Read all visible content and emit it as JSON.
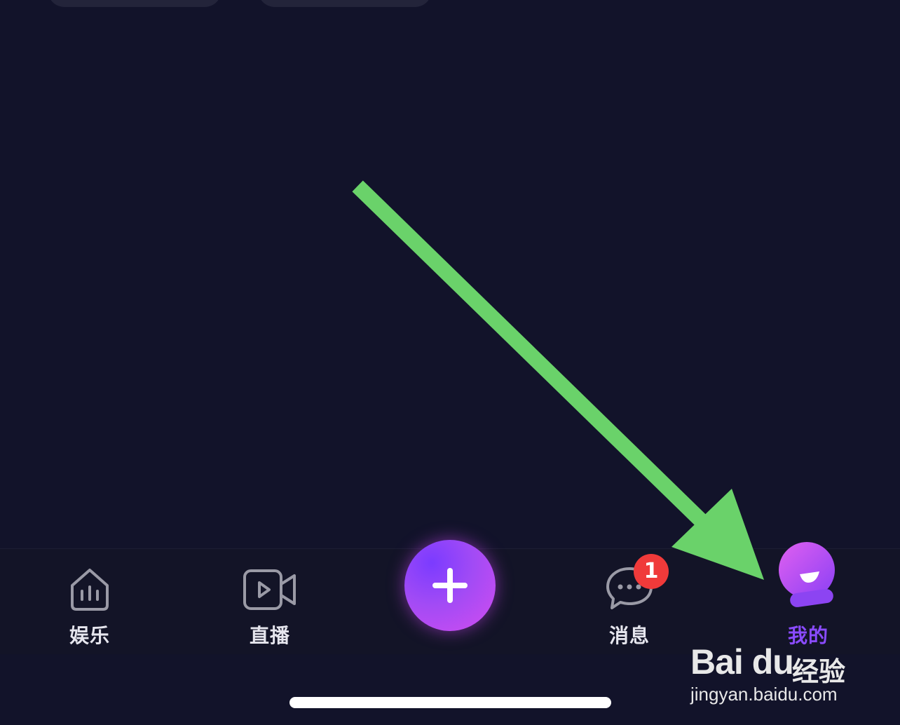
{
  "tabbar": {
    "items": [
      {
        "label": "娱乐",
        "icon": "home-icon",
        "active": false
      },
      {
        "label": "直播",
        "icon": "video-camera-icon",
        "active": false
      },
      {
        "label": "",
        "icon": "plus-icon",
        "active": false
      },
      {
        "label": "消息",
        "icon": "chat-bubble-icon",
        "active": false
      },
      {
        "label": "我的",
        "icon": "profile-mascot-icon",
        "active": true
      }
    ],
    "message_badge": "1"
  },
  "watermark": {
    "logo_text": "Bai du",
    "product": "经验",
    "url": "jingyan.baidu.com"
  },
  "colors": {
    "background": "#12132a",
    "accent": "#8a4bff",
    "badge": "#f03a3a",
    "arrow": "#6ad26a"
  }
}
